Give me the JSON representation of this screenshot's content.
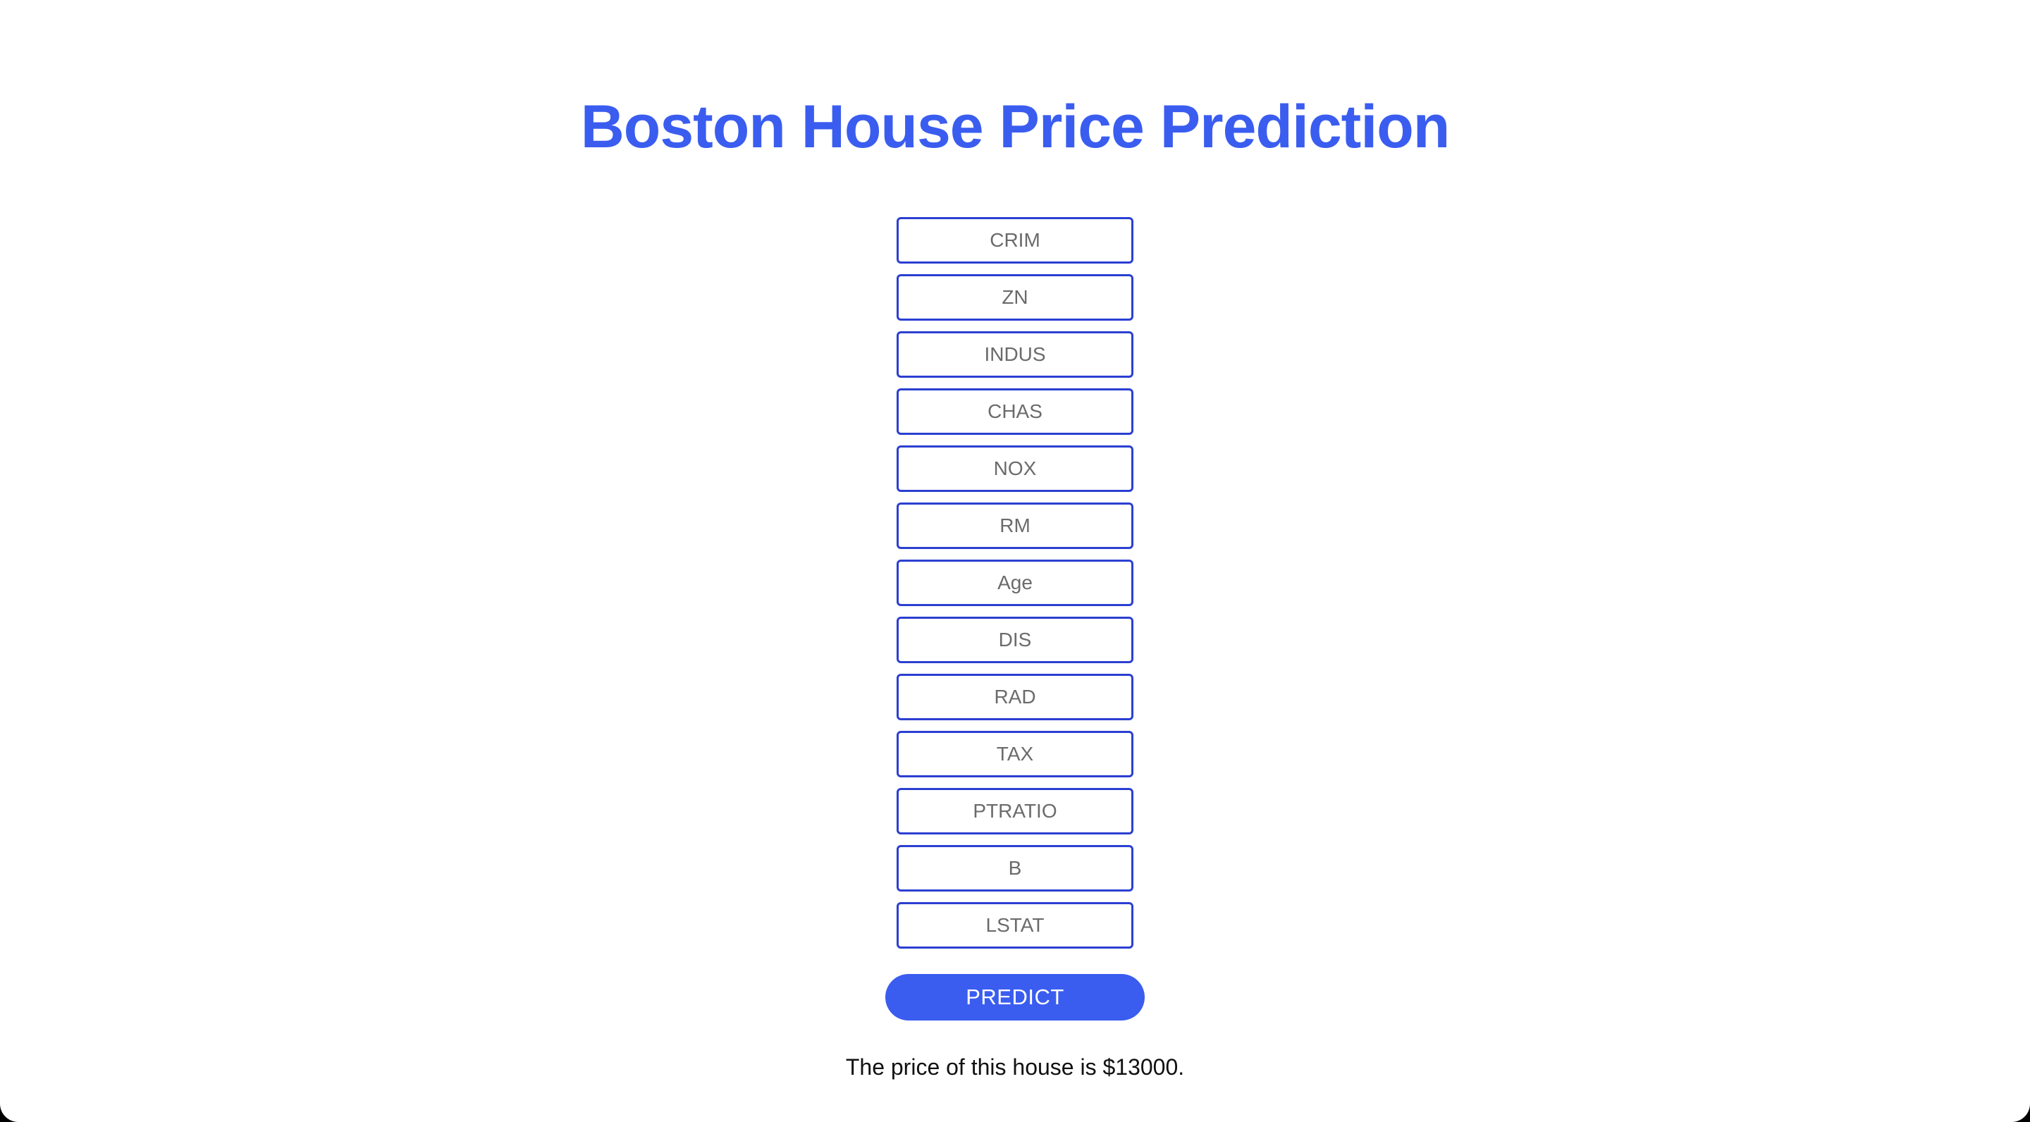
{
  "page": {
    "title": "Boston House Price Prediction"
  },
  "form": {
    "fields": [
      {
        "name": "crim",
        "placeholder": "CRIM",
        "value": ""
      },
      {
        "name": "zn",
        "placeholder": "ZN",
        "value": ""
      },
      {
        "name": "indus",
        "placeholder": "INDUS",
        "value": ""
      },
      {
        "name": "chas",
        "placeholder": "CHAS",
        "value": ""
      },
      {
        "name": "nox",
        "placeholder": "NOX",
        "value": ""
      },
      {
        "name": "rm",
        "placeholder": "RM",
        "value": ""
      },
      {
        "name": "age",
        "placeholder": "Age",
        "value": ""
      },
      {
        "name": "dis",
        "placeholder": "DIS",
        "value": ""
      },
      {
        "name": "rad",
        "placeholder": "RAD",
        "value": ""
      },
      {
        "name": "tax",
        "placeholder": "TAX",
        "value": ""
      },
      {
        "name": "ptratio",
        "placeholder": "PTRATIO",
        "value": ""
      },
      {
        "name": "b",
        "placeholder": "B",
        "value": ""
      },
      {
        "name": "lstat",
        "placeholder": "LSTAT",
        "value": ""
      }
    ],
    "submit_label": "PREDICT"
  },
  "result": {
    "text": "The price of this house is $13000."
  },
  "colors": {
    "accent": "#3a5df0",
    "field_border": "#2b3fd1",
    "background": "#ffffff"
  }
}
